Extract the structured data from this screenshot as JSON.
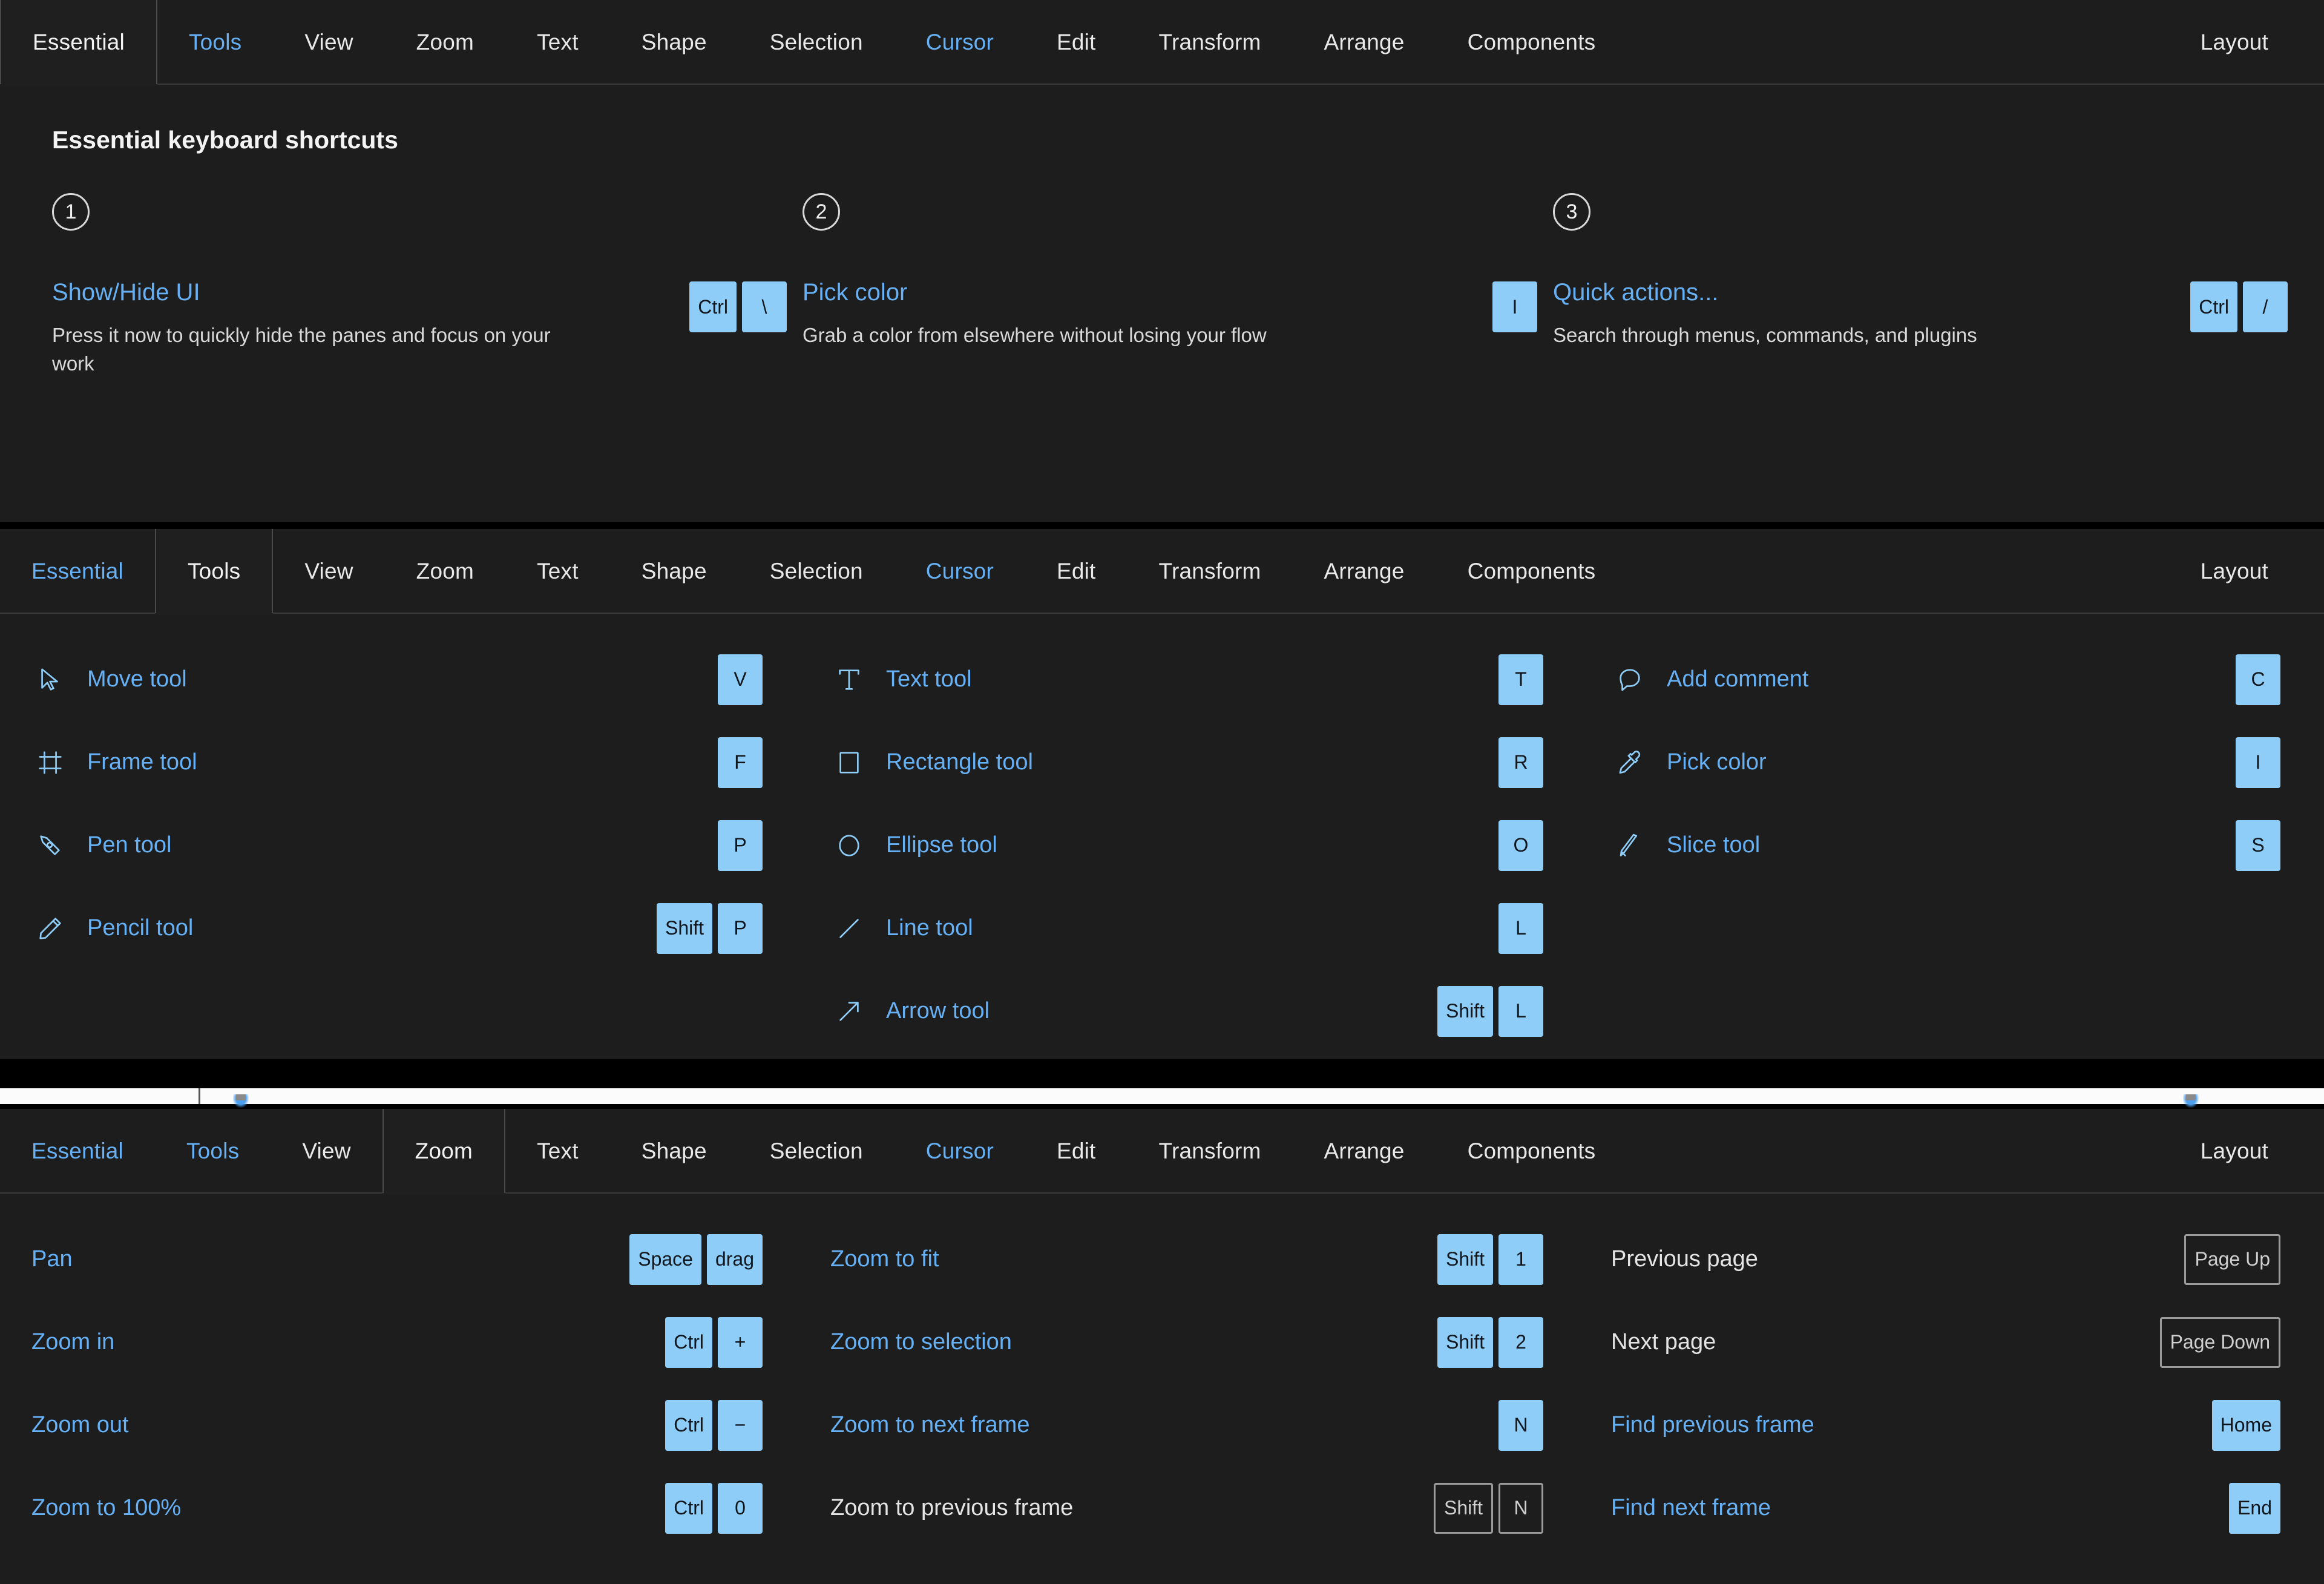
{
  "theme": {
    "bg": "#1d1d1d",
    "accent": "#66b0f5",
    "key_bg": "#8ecdf8",
    "key_fg": "#10161c",
    "text": "#e9e9e9"
  },
  "tabs": [
    "Essential",
    "Tools",
    "View",
    "Zoom",
    "Text",
    "Shape",
    "Selection",
    "Cursor",
    "Edit",
    "Transform",
    "Arrange",
    "Components",
    "Layout"
  ],
  "panels": [
    {
      "id": "essential",
      "active_tab": "Essential",
      "title": "Essential keyboard shortcuts",
      "cards": [
        {
          "number": "1",
          "name": "Show/Hide UI",
          "description": "Press it now to quickly hide the panes and focus on your work",
          "keys": [
            "Ctrl",
            "\\"
          ]
        },
        {
          "number": "2",
          "name": "Pick color",
          "description": "Grab a color from elsewhere without losing your flow",
          "keys": [
            "I"
          ]
        },
        {
          "number": "3",
          "name": "Quick actions...",
          "description": "Search through menus, commands, and plugins",
          "keys": [
            "Ctrl",
            "/"
          ]
        }
      ]
    },
    {
      "id": "tools",
      "active_tab": "Tools",
      "columns": [
        [
          {
            "icon": "cursor-arrow-icon",
            "label": "Move tool",
            "keys": [
              "V"
            ],
            "style": "filled"
          },
          {
            "icon": "frame-icon",
            "label": "Frame tool",
            "keys": [
              "F"
            ],
            "style": "filled"
          },
          {
            "icon": "pen-nib-icon",
            "label": "Pen tool",
            "keys": [
              "P"
            ],
            "style": "filled"
          },
          {
            "icon": "pencil-icon",
            "label": "Pencil tool",
            "keys": [
              "Shift",
              "P"
            ],
            "style": "filled"
          }
        ],
        [
          {
            "icon": "text-t-icon",
            "label": "Text tool",
            "keys": [
              "T"
            ],
            "style": "filled"
          },
          {
            "icon": "rectangle-icon",
            "label": "Rectangle tool",
            "keys": [
              "R"
            ],
            "style": "filled"
          },
          {
            "icon": "ellipse-icon",
            "label": "Ellipse tool",
            "keys": [
              "O"
            ],
            "style": "filled"
          },
          {
            "icon": "line-icon",
            "label": "Line tool",
            "keys": [
              "L"
            ],
            "style": "filled"
          },
          {
            "icon": "arrow-icon",
            "label": "Arrow tool",
            "keys": [
              "Shift",
              "L"
            ],
            "style": "filled"
          }
        ],
        [
          {
            "icon": "comment-bubble-icon",
            "label": "Add comment",
            "keys": [
              "C"
            ],
            "style": "filled"
          },
          {
            "icon": "eyedropper-icon",
            "label": "Pick color",
            "keys": [
              "I"
            ],
            "style": "filled"
          },
          {
            "icon": "slice-icon",
            "label": "Slice tool",
            "keys": [
              "S"
            ],
            "style": "filled"
          }
        ]
      ]
    },
    {
      "id": "zoom",
      "active_tab": "Zoom",
      "columns": [
        [
          {
            "label": "Pan",
            "keys": [
              "Space",
              "drag"
            ],
            "style": "filled",
            "label_style": "link"
          },
          {
            "label": "Zoom in",
            "keys": [
              "Ctrl",
              "+"
            ],
            "style": "filled",
            "label_style": "link"
          },
          {
            "label": "Zoom out",
            "keys": [
              "Ctrl",
              "−"
            ],
            "style": "filled",
            "label_style": "link"
          },
          {
            "label": "Zoom to 100%",
            "keys": [
              "Ctrl",
              "0"
            ],
            "style": "filled",
            "label_style": "link"
          }
        ],
        [
          {
            "label": "Zoom to fit",
            "keys": [
              "Shift",
              "1"
            ],
            "style": "filled",
            "label_style": "link"
          },
          {
            "label": "Zoom to selection",
            "keys": [
              "Shift",
              "2"
            ],
            "style": "filled",
            "label_style": "link"
          },
          {
            "label": "Zoom to next frame",
            "keys": [
              "N"
            ],
            "style": "filled",
            "label_style": "link"
          },
          {
            "label": "Zoom to previous frame",
            "keys": [
              "Shift",
              "N"
            ],
            "style": "outline",
            "label_style": "plain"
          }
        ],
        [
          {
            "label": "Previous page",
            "keys": [
              "Page Up"
            ],
            "style": "outline",
            "label_style": "plain"
          },
          {
            "label": "Next page",
            "keys": [
              "Page Down"
            ],
            "style": "outline",
            "label_style": "plain"
          },
          {
            "label": "Find previous frame",
            "keys": [
              "Home"
            ],
            "style": "filled",
            "label_style": "link"
          },
          {
            "label": "Find next frame",
            "keys": [
              "End"
            ],
            "style": "filled",
            "label_style": "link"
          }
        ]
      ]
    }
  ]
}
